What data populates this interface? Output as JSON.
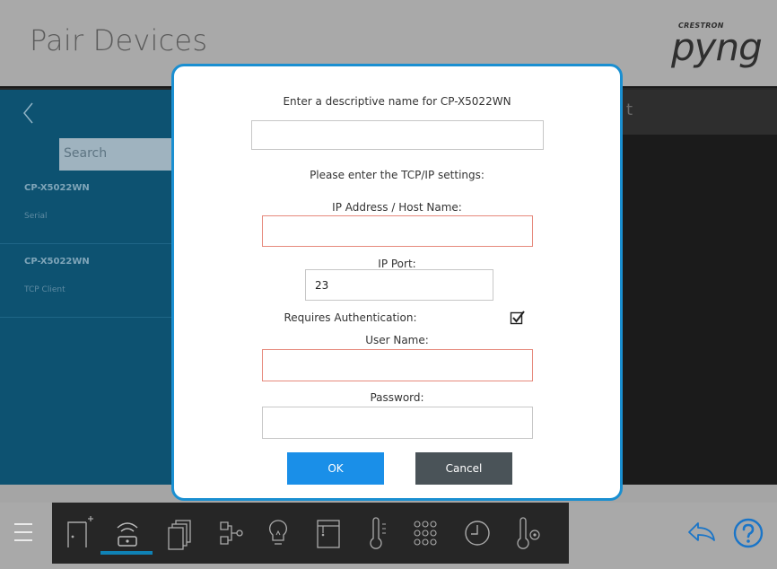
{
  "app": {
    "page_title": "Pair Devices",
    "logo": {
      "brand": "CRESTRON",
      "word": "pyng"
    },
    "search_placeholder": "Search",
    "ghost_header_fragment": "t",
    "devices": [
      {
        "name": "CP-X5022WN",
        "type": "Serial"
      },
      {
        "name": "CP-X5022WN",
        "type": "TCP Client"
      }
    ],
    "bottom_icons": [
      "menu-icon",
      "room-add-icon",
      "pair-device-icon",
      "devices-icon",
      "scene-icon",
      "lightbulb-icon",
      "shade-icon",
      "thermostat-icon",
      "keypad-icon",
      "clock-icon",
      "temperature-settings-icon"
    ],
    "right_icons": [
      "back-arrow-icon",
      "help-icon"
    ],
    "colors": {
      "accent": "#1a8fd1",
      "ok": "#1a8fe8",
      "cancel": "#4a5358",
      "error_border": "#e6897c",
      "panel": "#0d5271"
    }
  },
  "dialog": {
    "name_prompt": "Enter a descriptive name for CP-X5022WN",
    "name_value": "",
    "tcp_prompt": "Please enter the TCP/IP settings:",
    "ip_label": "IP Address / Host Name:",
    "ip_value": "",
    "port_label": "IP Port:",
    "port_value": "23",
    "auth_label": "Requires Authentication:",
    "auth_checked": true,
    "user_label": "User Name:",
    "user_value": "",
    "password_label": "Password:",
    "password_value": "",
    "ok_label": "OK",
    "cancel_label": "Cancel"
  }
}
